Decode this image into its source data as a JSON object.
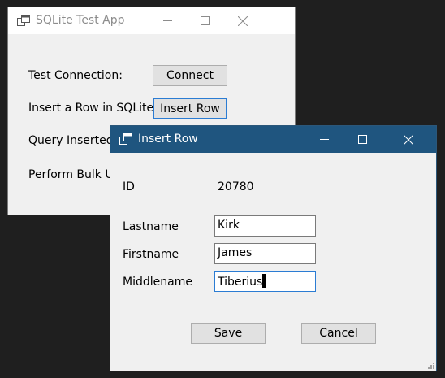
{
  "main_window": {
    "title": "SQLite Test App",
    "rows": [
      {
        "label": "Test Connection:",
        "button": "Connect"
      },
      {
        "label": "Insert a Row in SQLite",
        "button": "Insert Row"
      },
      {
        "label": "Query Inserted"
      },
      {
        "label": "Perform Bulk U"
      }
    ]
  },
  "insert_dialog": {
    "title": "Insert Row",
    "id_label": "ID",
    "id_value": "20780",
    "lastname_label": "Lastname",
    "lastname_value": "Kirk",
    "firstname_label": "Firstname",
    "firstname_value": "James",
    "middlename_label": "Middlename",
    "middlename_value": "Tiberius",
    "save_label": "Save",
    "cancel_label": "Cancel"
  },
  "icons": {
    "app_icon": "app-window-icon",
    "minimize": "minimize-icon",
    "maximize": "maximize-icon",
    "close": "close-icon"
  },
  "colors": {
    "active_titlebar": "#1f557f",
    "desktop": "#1f1f1f",
    "focus_border": "#2b7cd3"
  }
}
